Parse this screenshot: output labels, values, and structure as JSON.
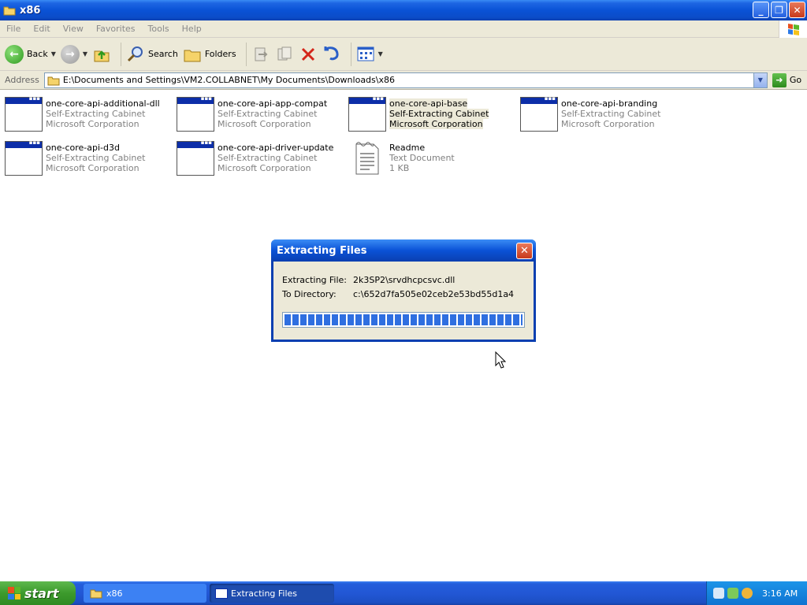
{
  "window": {
    "title": "x86"
  },
  "menu": [
    "File",
    "Edit",
    "View",
    "Favorites",
    "Tools",
    "Help"
  ],
  "toolbar": {
    "back_label": "Back",
    "search_label": "Search",
    "folders_label": "Folders"
  },
  "address": {
    "label": "Address",
    "value": "E:\\Documents and Settings\\VM2.COLLABNET\\My Documents\\Downloads\\x86",
    "go_label": "Go"
  },
  "files": [
    {
      "name": "one-core-api-additional-dll",
      "type": "Self-Extracting Cabinet",
      "detail": "Microsoft Corporation",
      "icon": "cabinet-icon"
    },
    {
      "name": "one-core-api-app-compat",
      "type": "Self-Extracting Cabinet",
      "detail": "Microsoft Corporation",
      "icon": "cabinet-icon"
    },
    {
      "name": "one-core-api-base",
      "type": "Self-Extracting Cabinet",
      "detail": "Microsoft Corporation",
      "icon": "cabinet-icon",
      "selected": true
    },
    {
      "name": "one-core-api-branding",
      "type": "Self-Extracting Cabinet",
      "detail": "Microsoft Corporation",
      "icon": "cabinet-icon"
    },
    {
      "name": "one-core-api-d3d",
      "type": "Self-Extracting Cabinet",
      "detail": "Microsoft Corporation",
      "icon": "cabinet-icon"
    },
    {
      "name": "one-core-api-driver-update",
      "type": "Self-Extracting Cabinet",
      "detail": "Microsoft Corporation",
      "icon": "cabinet-icon"
    },
    {
      "name": "Readme",
      "type": "Text Document",
      "detail": "1 KB",
      "icon": "text-document-icon"
    }
  ],
  "dialog": {
    "title": "Extracting Files",
    "file_label": "Extracting File:",
    "file_value": "2k3SP2\\srvdhcpcsvc.dll",
    "dir_label": "To Directory:",
    "dir_value": "c:\\652d7fa505e02ceb2e53bd55d1a4",
    "progress": 1.0
  },
  "taskbar": {
    "start_label": "start",
    "tasks": [
      "x86",
      "Extracting Files"
    ],
    "clock": "3:16 AM"
  },
  "colors": {
    "xp_blue": "#0a52d6",
    "start_green": "#3c9a2c",
    "selection_bg": "#ece9d8"
  }
}
